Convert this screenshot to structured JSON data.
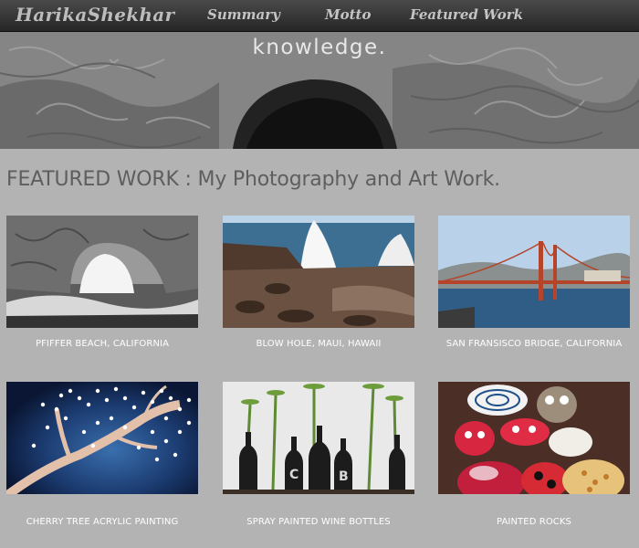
{
  "nav": {
    "brand": "HarikaShekhar",
    "links": [
      "Summary",
      "Motto",
      "Featured Work"
    ]
  },
  "hero": {
    "text": "knowledge."
  },
  "section": {
    "title": "FEATURED WORK : My Photography and Art Work."
  },
  "gallery": [
    {
      "caption": "PFIFFER BEACH, CALIFORNIA"
    },
    {
      "caption": "BLOW HOLE, MAUI, HAWAII"
    },
    {
      "caption": "SAN FRANSISCO BRIDGE, CALIFORNIA"
    },
    {
      "caption": "CHERRY TREE ACRYLIC PAINTING"
    },
    {
      "caption": "SPRAY PAINTED WINE BOTTLES"
    },
    {
      "caption": "PAINTED ROCKS"
    }
  ],
  "colors": {
    "page_background": "#b3b3b3",
    "navbar": "#2f2f2f",
    "heading_text": "#5e5e5e",
    "caption_text": "#ffffff"
  }
}
